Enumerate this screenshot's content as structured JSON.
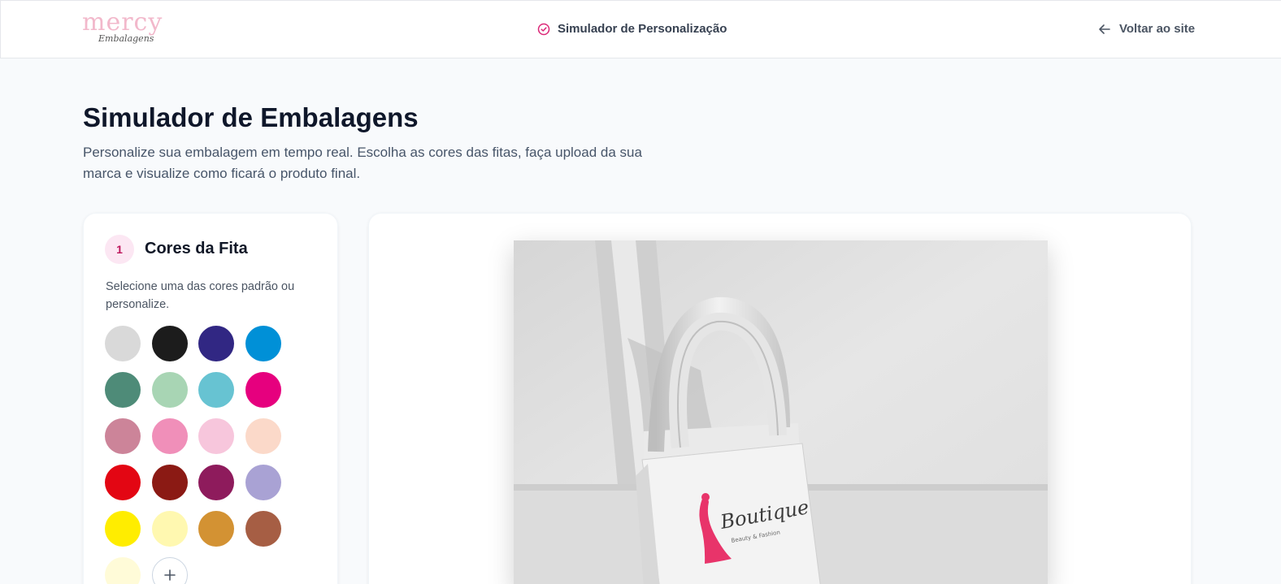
{
  "header": {
    "logo": {
      "main": "mercy",
      "sub": "Embalagens"
    },
    "center_title": "Simulador de Personalização",
    "back_label": "Voltar ao site"
  },
  "page": {
    "title": "Simulador de Embalagens",
    "description": "Personalize sua embalagem em tempo real. Escolha as cores das fitas, faça upload da sua marca e visualize como ficará o produto final."
  },
  "step": {
    "number": "1",
    "title": "Cores da Fita",
    "description": "Selecione uma das cores padrão ou personalize."
  },
  "swatches": [
    "#d9d9d9",
    "#1c1c1c",
    "#312783",
    "#0090d7",
    "#4e8b78",
    "#a8d5b4",
    "#67c3d2",
    "#e6007e",
    "#cc8499",
    "#f08fb9",
    "#f7c6dc",
    "#fbd9c9",
    "#e30613",
    "#8b1a14",
    "#8e1b5c",
    "#a9a2d4",
    "#ffed00",
    "#fff8b0",
    "#d39233",
    "#a65e44",
    "#fffbd8"
  ],
  "preview": {
    "brand_text": "Boutique",
    "brand_sub": "Beauty & Fashion"
  },
  "colors": {
    "accent": "#db2777",
    "badge_bg": "#fce7f3"
  }
}
